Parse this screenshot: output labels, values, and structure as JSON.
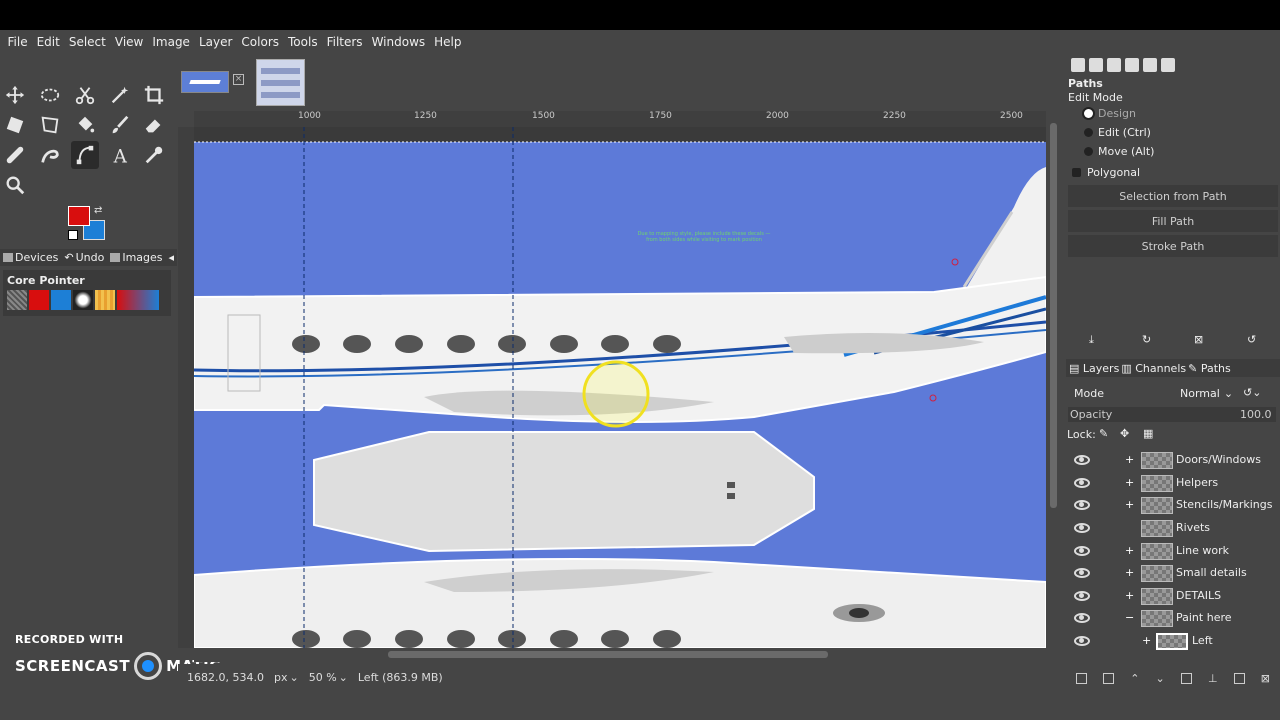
{
  "menu": [
    "File",
    "Edit",
    "Select",
    "View",
    "Image",
    "Layer",
    "Colors",
    "Tools",
    "Filters",
    "Windows",
    "Help"
  ],
  "toolbox": {
    "tools": [
      "move-tool",
      "ellipse-select-tool",
      "scissors-tool",
      "fuzzy-select-tool",
      "crop-tool",
      "transform-tool",
      "perspective-tool",
      "bucket-fill-tool",
      "paintbrush-tool",
      "eraser-tool",
      "heal-tool",
      "smudge-tool",
      "paths-tool",
      "text-tool",
      "color-picker-tool",
      "zoom-tool"
    ],
    "fg_color": "#d80e0e",
    "bg_color": "#1d7fd6",
    "tabs": [
      "Devices",
      "Undo",
      "Images"
    ],
    "brush_panel_title": "Core Pointer"
  },
  "ruler": {
    "h_labels": [
      "1000",
      "1250",
      "1500",
      "1750",
      "2000",
      "2250",
      "2500"
    ]
  },
  "canvas": {
    "note_text": "Due to mapping style, please include these decals — from both sides while visiting to mark position"
  },
  "statusbar": {
    "coords": "1682.0, 534.0",
    "unit": "px",
    "zoom": "50 %",
    "layer_info": "Left (863.9 MB)"
  },
  "watermark": {
    "line1": "RECORDED WITH",
    "line2a": "SCREENCAST",
    "line2b": "MATIC"
  },
  "paths_panel": {
    "title": "Paths",
    "edit_mode_label": "Edit Mode",
    "modes": [
      "Design",
      "Edit (Ctrl)",
      "Move (Alt)"
    ],
    "polygonal": "Polygonal",
    "buttons": [
      "Selection from Path",
      "Fill Path",
      "Stroke Path"
    ]
  },
  "layers_panel": {
    "tabs": [
      "Layers",
      "Channels",
      "Paths"
    ],
    "mode_label": "Mode",
    "mode_value": "Normal",
    "opacity_label": "Opacity",
    "opacity_value": "100.0",
    "lock_label": "Lock:",
    "layers": [
      {
        "name": "Doors/Windows",
        "chain": "+"
      },
      {
        "name": "Helpers",
        "chain": "+"
      },
      {
        "name": "Stencils/Markings",
        "chain": "+"
      },
      {
        "name": "Rivets",
        "chain": ""
      },
      {
        "name": "Line work",
        "chain": "+"
      },
      {
        "name": "Small details",
        "chain": "+"
      },
      {
        "name": "DETAILS",
        "chain": "+"
      },
      {
        "name": "Paint here",
        "chain": "−"
      },
      {
        "name": "Left",
        "chain": "+"
      }
    ]
  }
}
